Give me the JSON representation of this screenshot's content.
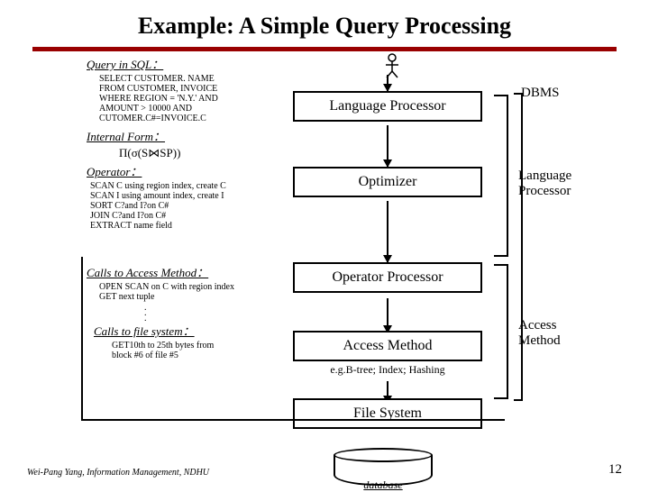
{
  "title": "Example: A Simple Query Processing",
  "left": {
    "query_hdr": "Query in SQL：",
    "query_sql": "SELECT CUSTOMER. NAME\nFROM CUSTOMER, INVOICE\nWHERE REGION = 'N.Y.' AND\nAMOUNT > 10000 AND\nCUTOMER.C#=INVOICE.C",
    "iform_hdr": "Internal Form：",
    "pi_expr": "Π(σ(S⋈SP))",
    "op_hdr": "Operator：",
    "op_txt": "SCAN C using region index, create C\nSCAN I using amount index, create I\nSORT C?and I?on C#\nJOIN C?and I?on C#\nEXTRACT name field",
    "calls_hdr": "Calls to Access Method：",
    "calls_txt": "OPEN SCAN on C with region index\nGET next tuple",
    "fs_hdr": "Calls to file system：",
    "fs_txt": "GET10th to 25th bytes from\nblock #6 of file #5"
  },
  "boxes": {
    "b1": "Language Processor",
    "b2": "Optimizer",
    "b3": "Operator Processor",
    "b4": "Access  Method",
    "b4_eg": "e.g.B-tree; Index; Hashing",
    "b5": "File  System"
  },
  "right": {
    "dbms": "DBMS",
    "r1": "Language\nProcessor",
    "r2": "Access\nMethod"
  },
  "db_label": "database",
  "footer": "Wei-Pang Yang, Information Management, NDHU",
  "page": "12"
}
